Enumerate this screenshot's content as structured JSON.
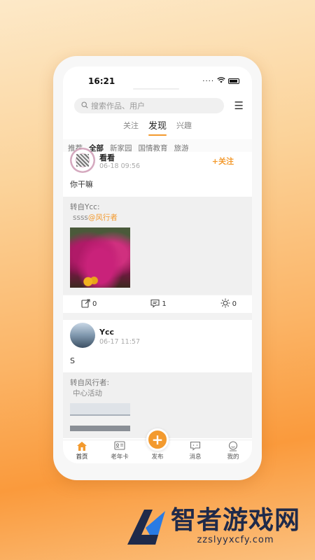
{
  "status": {
    "time": "16:21"
  },
  "search": {
    "placeholder": "搜索作品、用户"
  },
  "top_tabs": [
    "关注",
    "发现",
    "兴趣"
  ],
  "top_tabs_active": "发现",
  "sub_tabs": [
    "推荐",
    "全部",
    "新家园",
    "国情教育",
    "旅游"
  ],
  "sub_tabs_active": "全部",
  "posts": [
    {
      "user": "看看",
      "date": "06-18 09:56",
      "follow_label": "+关注",
      "content": "你干嘛",
      "repost_from": "转自Ycc:",
      "repost_text": "ssss",
      "repost_mention": "@风行者",
      "actions": {
        "forward": "0",
        "comment": "1",
        "like": "0"
      }
    },
    {
      "user": "Ycc",
      "date": "06-17 11:57",
      "content": "S",
      "repost_from": "转自风行者:",
      "repost_text": "中心活动"
    }
  ],
  "bottom_nav": {
    "home": "首页",
    "card": "老年卡",
    "publish": "发布",
    "messages": "消息",
    "mine": "我的"
  },
  "brand": {
    "name": "智者游戏网",
    "url": "zzslyyxcfy.com"
  },
  "colors": {
    "accent": "#f39a2e",
    "brand_dark": "#1f2a4a"
  }
}
